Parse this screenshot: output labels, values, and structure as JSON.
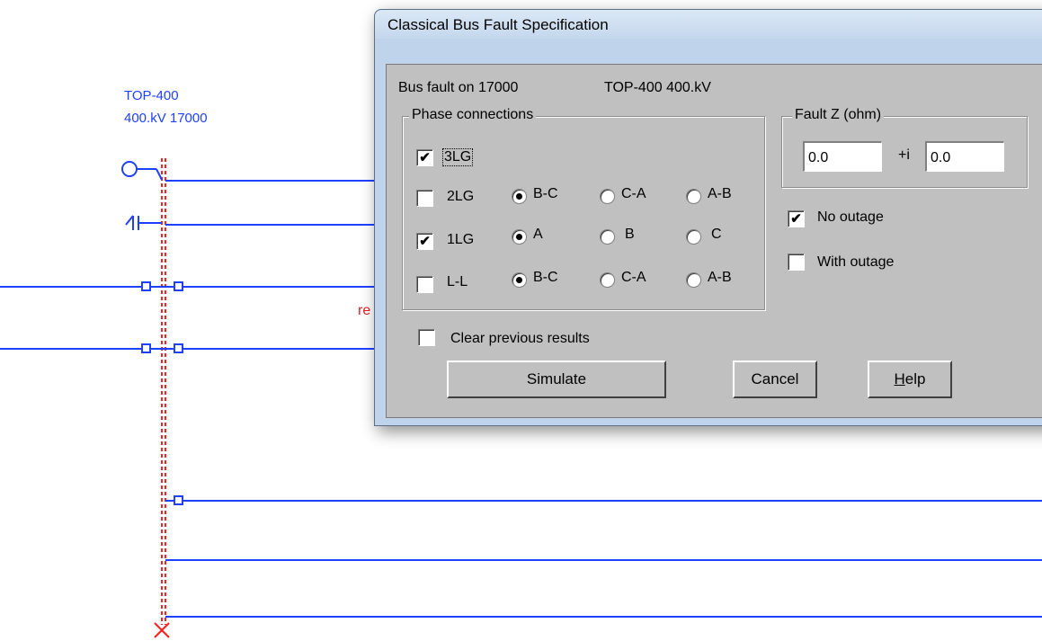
{
  "diagram": {
    "bus_name": "TOP-400",
    "bus_voltage_number": "400.kV 17000",
    "partial_red_text": "re"
  },
  "dialog": {
    "title": "Classical Bus Fault Specification",
    "bus_fault_label": "Bus fault on 17000",
    "bus_fault_name": "TOP-400  400.kV",
    "phase_connections": {
      "legend": "Phase connections",
      "rows": [
        {
          "label": "3LG",
          "checked": true,
          "options": []
        },
        {
          "label": "2LG",
          "checked": false,
          "options": [
            "B-C",
            "C-A",
            "A-B"
          ],
          "selected": "B-C"
        },
        {
          "label": "1LG",
          "checked": true,
          "options": [
            "A",
            "B",
            "C"
          ],
          "selected": "A"
        },
        {
          "label": "L-L",
          "checked": false,
          "options": [
            "B-C",
            "C-A",
            "A-B"
          ],
          "selected": "B-C"
        }
      ]
    },
    "fault_z": {
      "legend": "Fault Z (ohm)",
      "real_value": "0.0",
      "imag_label": "+i",
      "imag_value": "0.0"
    },
    "no_outage": {
      "label": "No outage",
      "checked": true
    },
    "with_outage": {
      "label": "With outage",
      "checked": false
    },
    "clear_previous": {
      "label": "Clear previous results",
      "checked": false
    },
    "buttons": {
      "simulate": "Simulate",
      "cancel": "Cancel",
      "help_mnemonic": "H",
      "help_rest": "elp"
    }
  }
}
